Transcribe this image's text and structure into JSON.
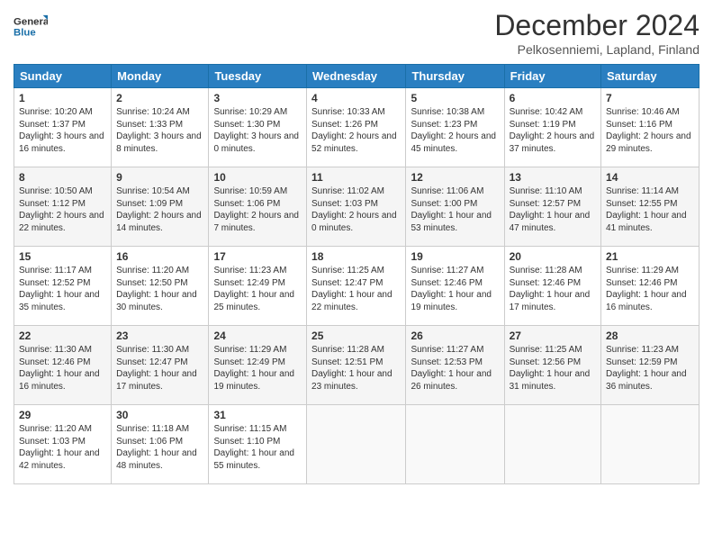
{
  "logo": {
    "general": "General",
    "blue": "Blue"
  },
  "title": "December 2024",
  "location": "Pelkosenniemi, Lapland, Finland",
  "days_of_week": [
    "Sunday",
    "Monday",
    "Tuesday",
    "Wednesday",
    "Thursday",
    "Friday",
    "Saturday"
  ],
  "weeks": [
    [
      {
        "day": "1",
        "sunrise": "10:20 AM",
        "sunset": "1:37 PM",
        "daylight": "3 hours and 16 minutes."
      },
      {
        "day": "2",
        "sunrise": "10:24 AM",
        "sunset": "1:33 PM",
        "daylight": "3 hours and 8 minutes."
      },
      {
        "day": "3",
        "sunrise": "10:29 AM",
        "sunset": "1:30 PM",
        "daylight": "3 hours and 0 minutes."
      },
      {
        "day": "4",
        "sunrise": "10:33 AM",
        "sunset": "1:26 PM",
        "daylight": "2 hours and 52 minutes."
      },
      {
        "day": "5",
        "sunrise": "10:38 AM",
        "sunset": "1:23 PM",
        "daylight": "2 hours and 45 minutes."
      },
      {
        "day": "6",
        "sunrise": "10:42 AM",
        "sunset": "1:19 PM",
        "daylight": "2 hours and 37 minutes."
      },
      {
        "day": "7",
        "sunrise": "10:46 AM",
        "sunset": "1:16 PM",
        "daylight": "2 hours and 29 minutes."
      }
    ],
    [
      {
        "day": "8",
        "sunrise": "10:50 AM",
        "sunset": "1:12 PM",
        "daylight": "2 hours and 22 minutes."
      },
      {
        "day": "9",
        "sunrise": "10:54 AM",
        "sunset": "1:09 PM",
        "daylight": "2 hours and 14 minutes."
      },
      {
        "day": "10",
        "sunrise": "10:59 AM",
        "sunset": "1:06 PM",
        "daylight": "2 hours and 7 minutes."
      },
      {
        "day": "11",
        "sunrise": "11:02 AM",
        "sunset": "1:03 PM",
        "daylight": "2 hours and 0 minutes."
      },
      {
        "day": "12",
        "sunrise": "11:06 AM",
        "sunset": "1:00 PM",
        "daylight": "1 hour and 53 minutes."
      },
      {
        "day": "13",
        "sunrise": "11:10 AM",
        "sunset": "12:57 PM",
        "daylight": "1 hour and 47 minutes."
      },
      {
        "day": "14",
        "sunrise": "11:14 AM",
        "sunset": "12:55 PM",
        "daylight": "1 hour and 41 minutes."
      }
    ],
    [
      {
        "day": "15",
        "sunrise": "11:17 AM",
        "sunset": "12:52 PM",
        "daylight": "1 hour and 35 minutes."
      },
      {
        "day": "16",
        "sunrise": "11:20 AM",
        "sunset": "12:50 PM",
        "daylight": "1 hour and 30 minutes."
      },
      {
        "day": "17",
        "sunrise": "11:23 AM",
        "sunset": "12:49 PM",
        "daylight": "1 hour and 25 minutes."
      },
      {
        "day": "18",
        "sunrise": "11:25 AM",
        "sunset": "12:47 PM",
        "daylight": "1 hour and 22 minutes."
      },
      {
        "day": "19",
        "sunrise": "11:27 AM",
        "sunset": "12:46 PM",
        "daylight": "1 hour and 19 minutes."
      },
      {
        "day": "20",
        "sunrise": "11:28 AM",
        "sunset": "12:46 PM",
        "daylight": "1 hour and 17 minutes."
      },
      {
        "day": "21",
        "sunrise": "11:29 AM",
        "sunset": "12:46 PM",
        "daylight": "1 hour and 16 minutes."
      }
    ],
    [
      {
        "day": "22",
        "sunrise": "11:30 AM",
        "sunset": "12:46 PM",
        "daylight": "1 hour and 16 minutes."
      },
      {
        "day": "23",
        "sunrise": "11:30 AM",
        "sunset": "12:47 PM",
        "daylight": "1 hour and 17 minutes."
      },
      {
        "day": "24",
        "sunrise": "11:29 AM",
        "sunset": "12:49 PM",
        "daylight": "1 hour and 19 minutes."
      },
      {
        "day": "25",
        "sunrise": "11:28 AM",
        "sunset": "12:51 PM",
        "daylight": "1 hour and 23 minutes."
      },
      {
        "day": "26",
        "sunrise": "11:27 AM",
        "sunset": "12:53 PM",
        "daylight": "1 hour and 26 minutes."
      },
      {
        "day": "27",
        "sunrise": "11:25 AM",
        "sunset": "12:56 PM",
        "daylight": "1 hour and 31 minutes."
      },
      {
        "day": "28",
        "sunrise": "11:23 AM",
        "sunset": "12:59 PM",
        "daylight": "1 hour and 36 minutes."
      }
    ],
    [
      {
        "day": "29",
        "sunrise": "11:20 AM",
        "sunset": "1:03 PM",
        "daylight": "1 hour and 42 minutes."
      },
      {
        "day": "30",
        "sunrise": "11:18 AM",
        "sunset": "1:06 PM",
        "daylight": "1 hour and 48 minutes."
      },
      {
        "day": "31",
        "sunrise": "11:15 AM",
        "sunset": "1:10 PM",
        "daylight": "1 hour and 55 minutes."
      },
      null,
      null,
      null,
      null
    ]
  ]
}
